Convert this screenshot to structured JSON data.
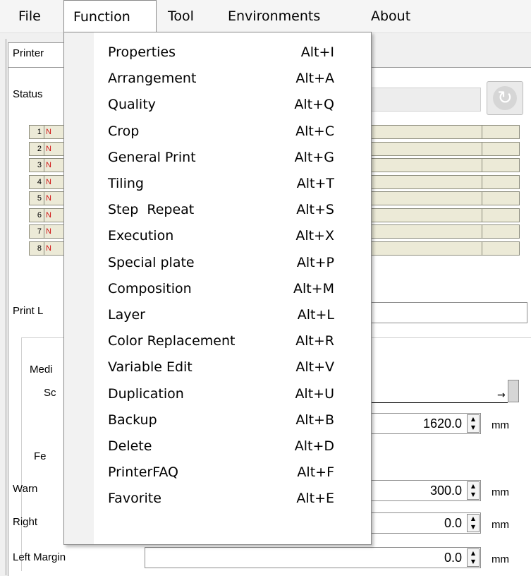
{
  "menubar": {
    "items": [
      "File",
      "Function",
      "Tool",
      "Environments",
      "About"
    ],
    "open_item": "Function"
  },
  "tab": {
    "label": "Printer"
  },
  "labels": {
    "status": "Status",
    "print_l": "Print L",
    "media": "Medi",
    "sc": "Sc",
    "fe": "Fe",
    "warn": "Warn",
    "right": "Right",
    "left_margin": "Left Margin"
  },
  "slots": [
    {
      "num": "1",
      "mark": "N"
    },
    {
      "num": "2",
      "mark": "N"
    },
    {
      "num": "3",
      "mark": "N"
    },
    {
      "num": "4",
      "mark": "N"
    },
    {
      "num": "5",
      "mark": "N"
    },
    {
      "num": "6",
      "mark": "N"
    },
    {
      "num": "7",
      "mark": "N"
    },
    {
      "num": "8",
      "mark": "N"
    }
  ],
  "fields": {
    "media_length": "1620.0",
    "warn_value": "300.0",
    "right_margin": "0.0",
    "left_margin": "0.0",
    "unit": "mm"
  },
  "function_menu": [
    {
      "label": "Properties",
      "shortcut": "Alt+I"
    },
    {
      "label": "Arrangement",
      "shortcut": "Alt+A"
    },
    {
      "label": "Quality",
      "shortcut": "Alt+Q"
    },
    {
      "label": "Crop",
      "shortcut": "Alt+C"
    },
    {
      "label": "General Print",
      "shortcut": "Alt+G"
    },
    {
      "label": "Tiling",
      "shortcut": "Alt+T"
    },
    {
      "label": "Step  Repeat",
      "shortcut": "Alt+S"
    },
    {
      "label": "Execution",
      "shortcut": "Alt+X"
    },
    {
      "label": "Special plate",
      "shortcut": "Alt+P"
    },
    {
      "label": "Composition",
      "shortcut": "Alt+M"
    },
    {
      "label": "Layer",
      "shortcut": "Alt+L"
    },
    {
      "label": "Color Replacement",
      "shortcut": "Alt+R"
    },
    {
      "label": "Variable Edit",
      "shortcut": "Alt+V"
    },
    {
      "label": "Duplication",
      "shortcut": "Alt+U"
    },
    {
      "label": "Backup",
      "shortcut": "Alt+B"
    },
    {
      "label": "Delete",
      "shortcut": "Alt+D"
    },
    {
      "label": "PrinterFAQ",
      "shortcut": "Alt+F"
    },
    {
      "label": "Favorite",
      "shortcut": "Alt+E"
    }
  ],
  "icons": {
    "refresh": "refresh-icon",
    "spin": "spinner-arrows-icon"
  },
  "colors": {
    "slot_fill": "#ecead7",
    "slot_mark": "#d01010",
    "menu_gutter": "#f2f2f2"
  }
}
